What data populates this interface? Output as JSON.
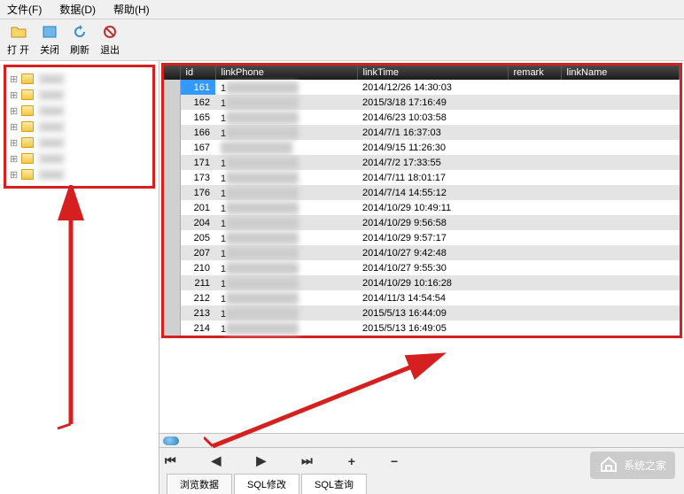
{
  "menu": {
    "file": "文件(F)",
    "data": "数据(D)",
    "help": "帮助(H)"
  },
  "toolbar": {
    "open": "打 开",
    "close": "关闭",
    "refresh": "刷新",
    "exit": "退出"
  },
  "tree": {
    "items": [
      "",
      "",
      "",
      "",
      "",
      "",
      ""
    ]
  },
  "grid": {
    "headers": {
      "id": "id",
      "linkPhone": "linkPhone",
      "linkTime": "linkTime",
      "remark": "remark",
      "linkName": "linkName"
    },
    "rows": [
      {
        "id": "161",
        "phone": "1",
        "time": "2014/12/26 14:30:03"
      },
      {
        "id": "162",
        "phone": "1",
        "time": "2015/3/18 17:16:49"
      },
      {
        "id": "165",
        "phone": "1",
        "time": "2014/6/23 10:03:58"
      },
      {
        "id": "166",
        "phone": "1",
        "time": "2014/7/1 16:37:03"
      },
      {
        "id": "167",
        "phone": "",
        "time": "2014/9/15 11:26:30"
      },
      {
        "id": "171",
        "phone": "1",
        "time": "2014/7/2 17:33:55"
      },
      {
        "id": "173",
        "phone": "1",
        "time": "2014/7/11 18:01:17"
      },
      {
        "id": "176",
        "phone": "1",
        "time": "2014/7/14 14:55:12"
      },
      {
        "id": "201",
        "phone": "1",
        "time": "2014/10/29 10:49:11"
      },
      {
        "id": "204",
        "phone": "1",
        "time": "2014/10/29 9:56:58"
      },
      {
        "id": "205",
        "phone": "1",
        "time": "2014/10/29 9:57:17"
      },
      {
        "id": "207",
        "phone": "1",
        "time": "2014/10/27 9:42:48"
      },
      {
        "id": "210",
        "phone": "1",
        "time": "2014/10/27 9:55:30"
      },
      {
        "id": "211",
        "phone": "1",
        "time": "2014/10/29 10:16:28"
      },
      {
        "id": "212",
        "phone": "1",
        "time": "2014/11/3 14:54:54"
      },
      {
        "id": "213",
        "phone": "1",
        "time": "2015/5/13 16:44:09"
      },
      {
        "id": "214",
        "phone": "1",
        "time": "2015/5/13 16:49:05"
      }
    ]
  },
  "nav": {
    "first": "⏮",
    "prev": "◀",
    "next": "▶",
    "last": "⏭",
    "add": "+",
    "del": "−"
  },
  "tabs": {
    "browse": "浏览数据",
    "sqlModify": "SQL修改",
    "sqlQuery": "SQL查询"
  },
  "watermark": "系统之家"
}
